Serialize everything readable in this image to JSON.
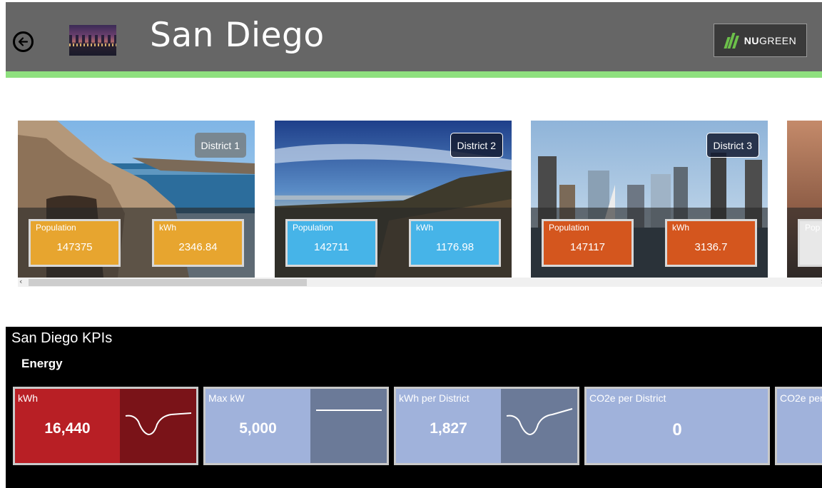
{
  "header": {
    "title": "San Diego",
    "brand_bold": "NU",
    "brand_light": "GREEN",
    "back_icon": "back-arrow-icon",
    "header_color": "#666666",
    "accent_strip_color": "#8ee07e"
  },
  "districts": [
    {
      "name": "District 1",
      "population_label": "Population",
      "population": "147375",
      "kwh_label": "kWh",
      "kwh": "2346.84",
      "color": "#e7a52f"
    },
    {
      "name": "District 2",
      "population_label": "Population",
      "population": "142711",
      "kwh_label": "kWh",
      "kwh": "1176.98",
      "color": "#46b4e8"
    },
    {
      "name": "District 3",
      "population_label": "Population",
      "population": "147117",
      "kwh_label": "kWh",
      "kwh": "3136.7",
      "color": "#d4561e"
    },
    {
      "partial_label": "Pop"
    }
  ],
  "kpis": {
    "title": "San Diego KPIs",
    "section": "Energy",
    "tiles": [
      {
        "label": "kWh",
        "value": "16,440",
        "color": "#b81f25",
        "chart_color": "#7a1318",
        "trend": "dip"
      },
      {
        "label": "Max kW",
        "value": "5,000",
        "color": "#a0b2db",
        "chart_color": "#6b7a98",
        "trend": "flat"
      },
      {
        "label": "kWh per District",
        "value": "1,827",
        "color": "#a0b2db",
        "chart_color": "#6b7a98",
        "trend": "dip"
      },
      {
        "label": "CO2e per District",
        "value": "0",
        "color": "#a0b2db"
      },
      {
        "label": "CO2e per"
      }
    ]
  }
}
